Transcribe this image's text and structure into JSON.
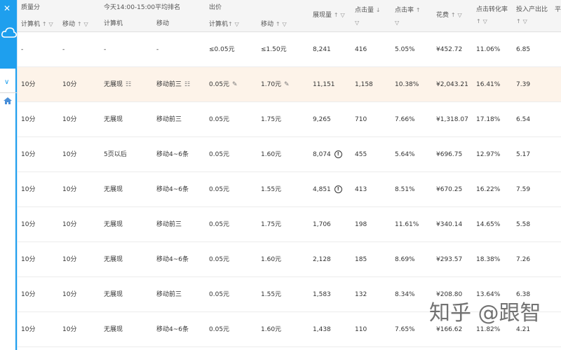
{
  "header": {
    "quality": "质量分",
    "quality_pc": "计算机",
    "quality_mobile": "移动",
    "rank_group": "今天14:00-15:00平均排名",
    "rank_pc": "计算机",
    "rank_mobile": "移动",
    "bid_group": "出价",
    "bid_pc": "计算机",
    "bid_mobile": "移动",
    "impressions": "展现量",
    "clicks": "点击量",
    "ctr": "点击率",
    "cost": "花费",
    "conversion": "点击转化率",
    "roi": "投入产出比",
    "avg_cut": "平"
  },
  "rows": [
    {
      "q_pc": "-",
      "q_m": "-",
      "r_pc": "-",
      "r_m": "-",
      "b_pc": "≤0.05元",
      "b_m": "≤1.50元",
      "imp": "8,241",
      "clk": "416",
      "ctr": "5.05%",
      "cost": "¥452.72",
      "conv": "11.06%",
      "roi": "6.85"
    },
    {
      "q_pc": "10分",
      "q_m": "10分",
      "r_pc": "无展现",
      "r_m": "移动前三",
      "b_pc": "0.05元",
      "b_m": "1.70元",
      "imp": "11,151",
      "clk": "1,158",
      "ctr": "10.38%",
      "cost": "¥2,043.21",
      "conv": "16.41%",
      "roi": "7.39"
    },
    {
      "q_pc": "10分",
      "q_m": "10分",
      "r_pc": "无展现",
      "r_m": "移动前三",
      "b_pc": "0.05元",
      "b_m": "1.75元",
      "imp": "9,265",
      "clk": "710",
      "ctr": "7.66%",
      "cost": "¥1,318.07",
      "conv": "17.18%",
      "roi": "6.54"
    },
    {
      "q_pc": "10分",
      "q_m": "10分",
      "r_pc": "5页以后",
      "r_m": "移动4~6条",
      "b_pc": "0.05元",
      "b_m": "1.60元",
      "imp": "8,074",
      "clk": "455",
      "ctr": "5.64%",
      "cost": "¥696.75",
      "conv": "12.97%",
      "roi": "5.17"
    },
    {
      "q_pc": "10分",
      "q_m": "10分",
      "r_pc": "无展现",
      "r_m": "移动4~6条",
      "b_pc": "0.05元",
      "b_m": "1.55元",
      "imp": "4,851",
      "clk": "413",
      "ctr": "8.51%",
      "cost": "¥670.25",
      "conv": "16.22%",
      "roi": "7.59"
    },
    {
      "q_pc": "10分",
      "q_m": "10分",
      "r_pc": "无展现",
      "r_m": "移动前三",
      "b_pc": "0.05元",
      "b_m": "1.75元",
      "imp": "1,706",
      "clk": "198",
      "ctr": "11.61%",
      "cost": "¥340.14",
      "conv": "14.65%",
      "roi": "5.58"
    },
    {
      "q_pc": "10分",
      "q_m": "10分",
      "r_pc": "无展现",
      "r_m": "移动4~6条",
      "b_pc": "0.05元",
      "b_m": "1.60元",
      "imp": "2,128",
      "clk": "185",
      "ctr": "8.69%",
      "cost": "¥293.57",
      "conv": "18.38%",
      "roi": "7.26"
    },
    {
      "q_pc": "10分",
      "q_m": "10分",
      "r_pc": "无展现",
      "r_m": "移动前三",
      "b_pc": "0.05元",
      "b_m": "1.55元",
      "imp": "1,583",
      "clk": "132",
      "ctr": "8.34%",
      "cost": "¥208.80",
      "conv": "13.64%",
      "roi": "6.38"
    },
    {
      "q_pc": "10分",
      "q_m": "10分",
      "r_pc": "无展现",
      "r_m": "移动4~6条",
      "b_pc": "0.05元",
      "b_m": "1.60元",
      "imp": "1,438",
      "clk": "110",
      "ctr": "7.65%",
      "cost": "¥166.62",
      "conv": "11.82%",
      "roi": "4.21"
    }
  ],
  "watermark": "知乎 @跟智",
  "icons": {
    "sort": "sort-icon",
    "filter": "filter-icon",
    "edit": "edit-icon",
    "info": "info-icon",
    "rank-list": "rank-list-icon"
  },
  "colors": {
    "sidebar_blue": "#1e9fee",
    "highlight_row": "#fdf3e9",
    "header_bg": "#f5f5f5"
  }
}
